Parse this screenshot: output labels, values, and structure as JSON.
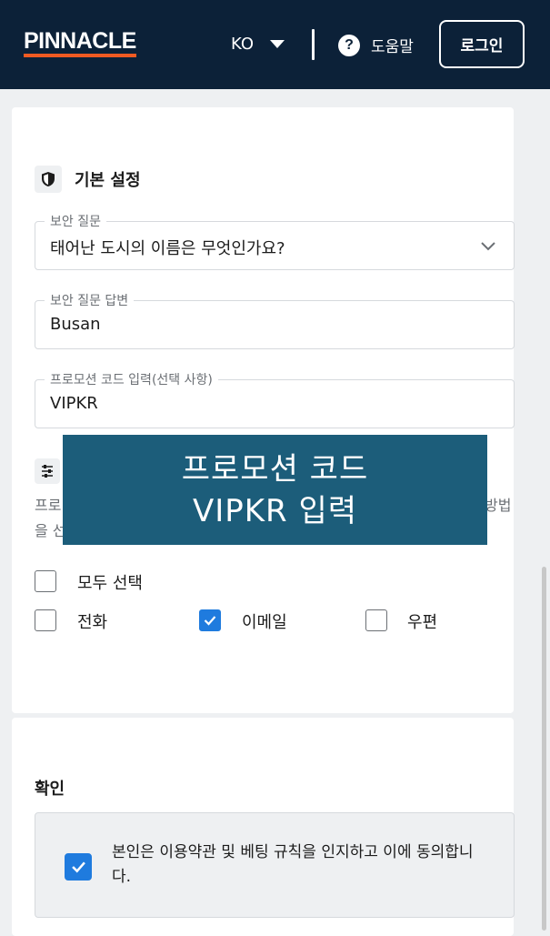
{
  "header": {
    "logo": "PINNACLE",
    "language": "KO",
    "help_label": "도움말",
    "help_icon_glyph": "?",
    "login_label": "로그인"
  },
  "basic_settings": {
    "title": "기본 설정",
    "security_question": {
      "label": "보안 질문",
      "value": "태어난 도시의 이름은 무엇인가요?"
    },
    "security_answer": {
      "label": "보안 질문 답변",
      "value": "Busan"
    },
    "promo_code": {
      "label": "프로모션 코드 입력(선택 사항)",
      "value": "VIPKR"
    }
  },
  "contact_prefs": {
    "desc_line1_fragment": "프로",
    "desc_line1_end_fragment": "방법",
    "desc_line2_fragment": "을 선",
    "select_all_label": "모두 선택",
    "select_all_checked": false,
    "options": [
      {
        "label": "전화",
        "checked": false
      },
      {
        "label": "이메일",
        "checked": true
      },
      {
        "label": "우편",
        "checked": false
      }
    ]
  },
  "overlay": {
    "line1": "프로모션 코드",
    "line2": "VIPKR 입력"
  },
  "confirm": {
    "title": "확인",
    "consent_text": "본인은 이용약관 및 베팅 규칙을 인지하고 이에 동의합니다.",
    "consent_checked": true
  },
  "colors": {
    "header_bg": "#0c2138",
    "logo_underline": "#f05a22",
    "checkbox_blue": "#1f7bde",
    "overlay_bg": "#1c5d7a"
  }
}
